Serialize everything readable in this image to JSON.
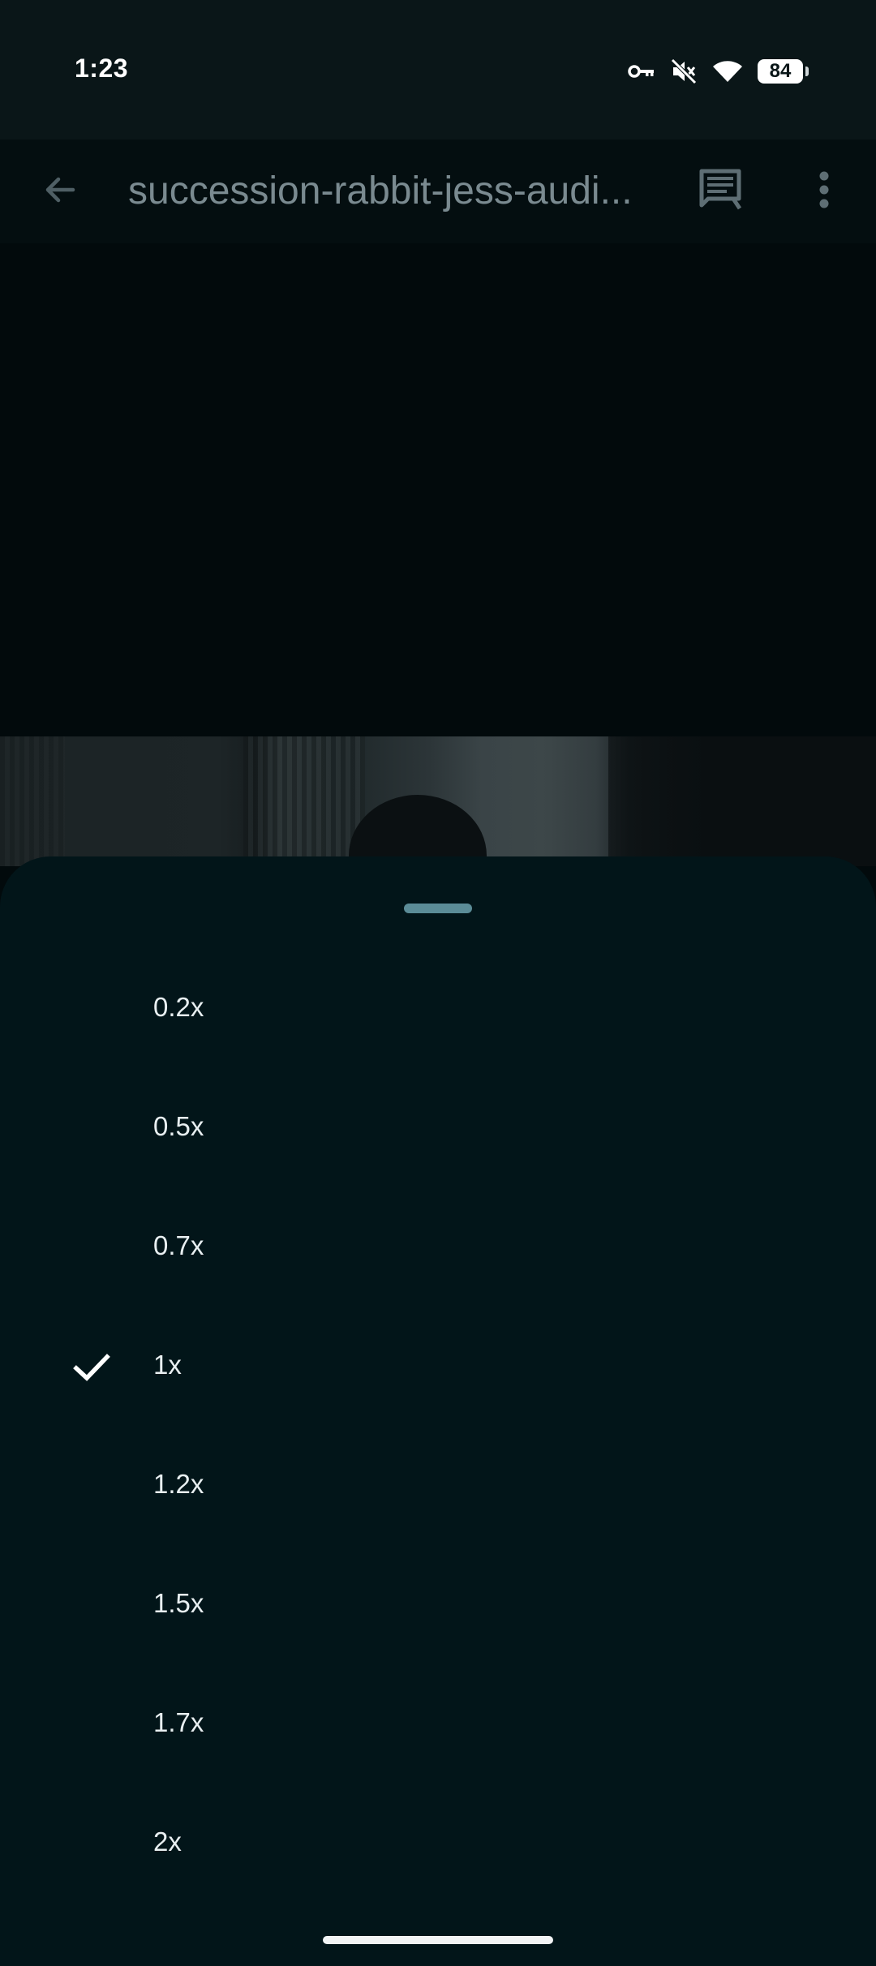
{
  "status_bar": {
    "time": "1:23",
    "battery": "84",
    "icons": [
      "vpn-key-icon",
      "mute-icon",
      "wifi-icon",
      "battery-icon"
    ]
  },
  "app_bar": {
    "title": "succession-rabbit-jess-audi...",
    "back_icon": "arrow-back-icon",
    "comment_icon": "comment-icon",
    "more_icon": "more-vert-icon"
  },
  "speed_sheet": {
    "options": [
      {
        "label": "0.2x",
        "selected": false
      },
      {
        "label": "0.5x",
        "selected": false
      },
      {
        "label": "0.7x",
        "selected": false
      },
      {
        "label": "1x",
        "selected": true
      },
      {
        "label": "1.2x",
        "selected": false
      },
      {
        "label": "1.5x",
        "selected": false
      },
      {
        "label": "1.7x",
        "selected": false
      },
      {
        "label": "2x",
        "selected": false
      }
    ],
    "check_icon": "checkmark-icon"
  },
  "colors": {
    "sheet_background": "#021519",
    "drag_handle": "#5b8c97",
    "title_text": "#7a8a90"
  }
}
